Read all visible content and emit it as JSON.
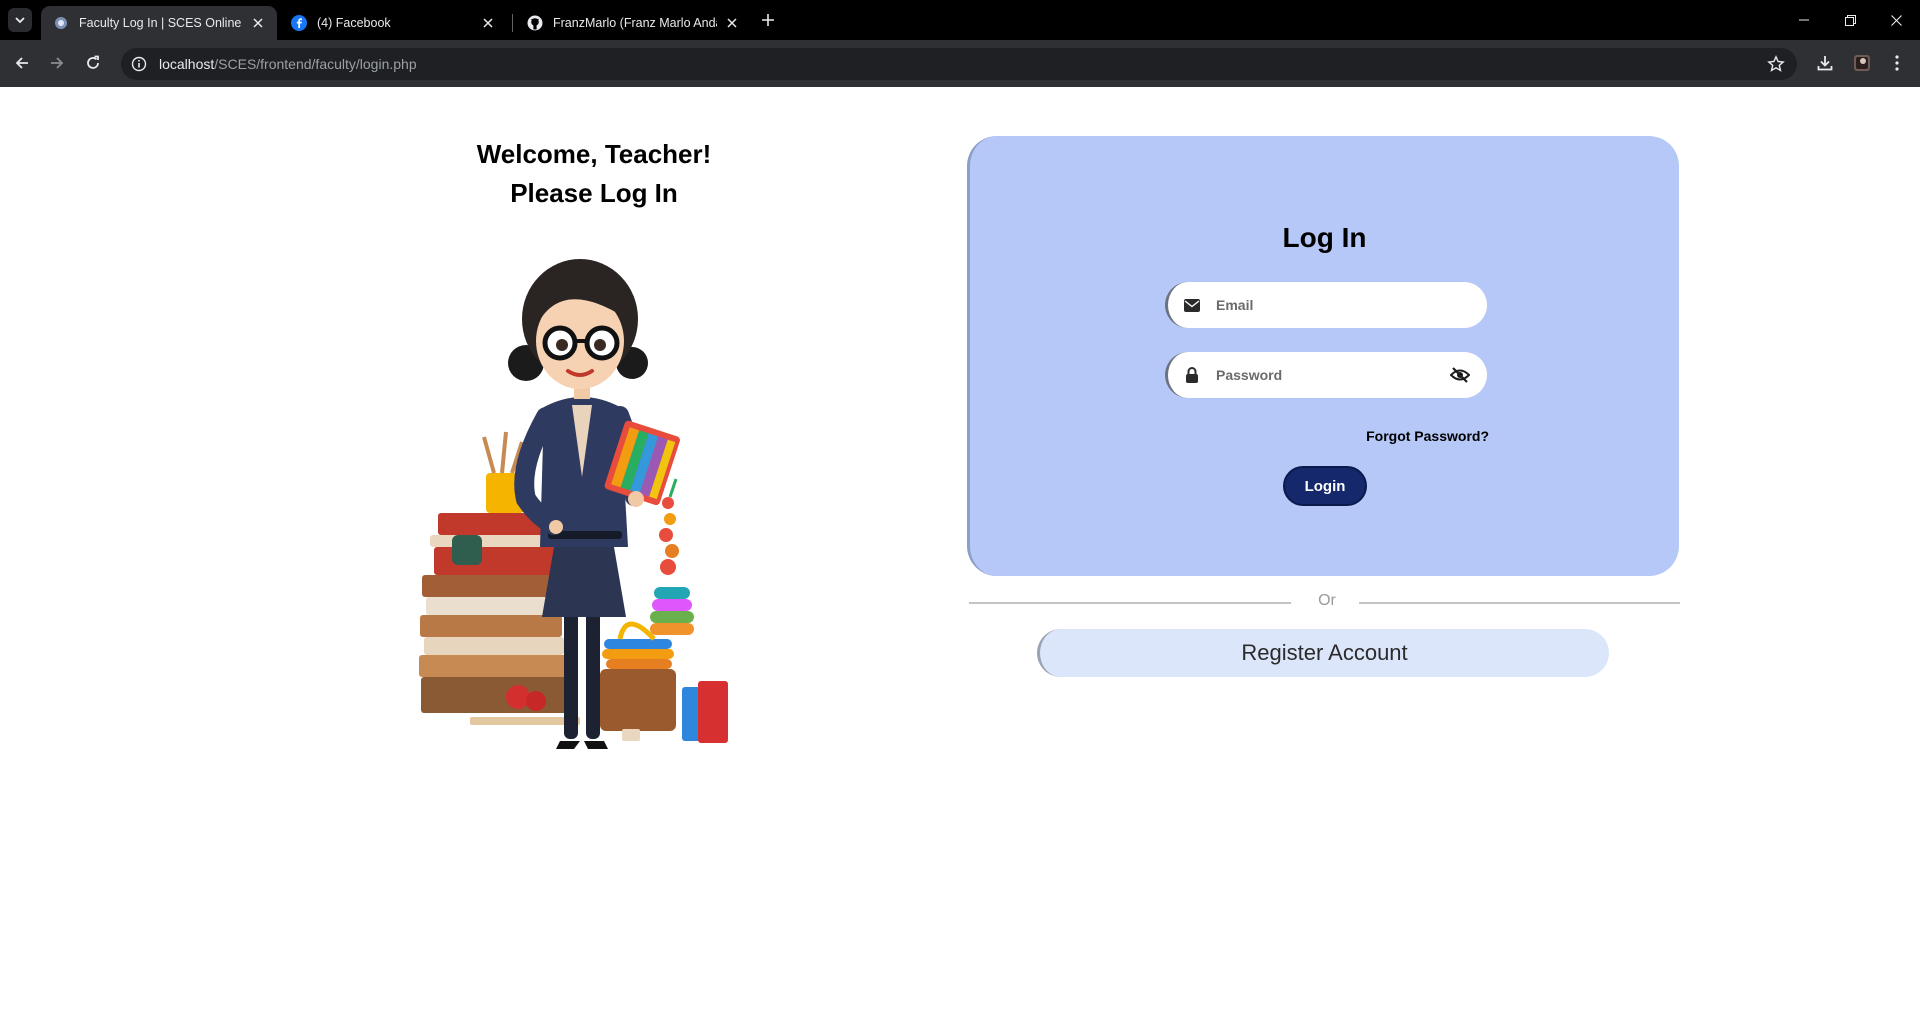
{
  "browser": {
    "tabs": [
      {
        "title": "Faculty Log In | SCES Online Lea",
        "active": true,
        "favicon": "globe-icon"
      },
      {
        "title": "(4) Facebook",
        "active": false,
        "favicon": "facebook-icon"
      },
      {
        "title": "FranzMarlo (Franz Marlo Andal)",
        "active": false,
        "favicon": "github-icon"
      }
    ],
    "url_host": "localhost",
    "url_path": "/SCES/frontend/faculty/login.php"
  },
  "welcome": {
    "line1": "Welcome, Teacher!",
    "line2": "Please Log In"
  },
  "login": {
    "title": "Log In",
    "email_placeholder": "Email",
    "password_placeholder": "Password",
    "forgot_label": "Forgot Password?",
    "button_label": "Login"
  },
  "divider_text": "Or",
  "register_label": "Register Account",
  "colors": {
    "card_bg": "#b6c8f7",
    "login_button": "#14286b",
    "register_bg": "#dce6fb"
  }
}
